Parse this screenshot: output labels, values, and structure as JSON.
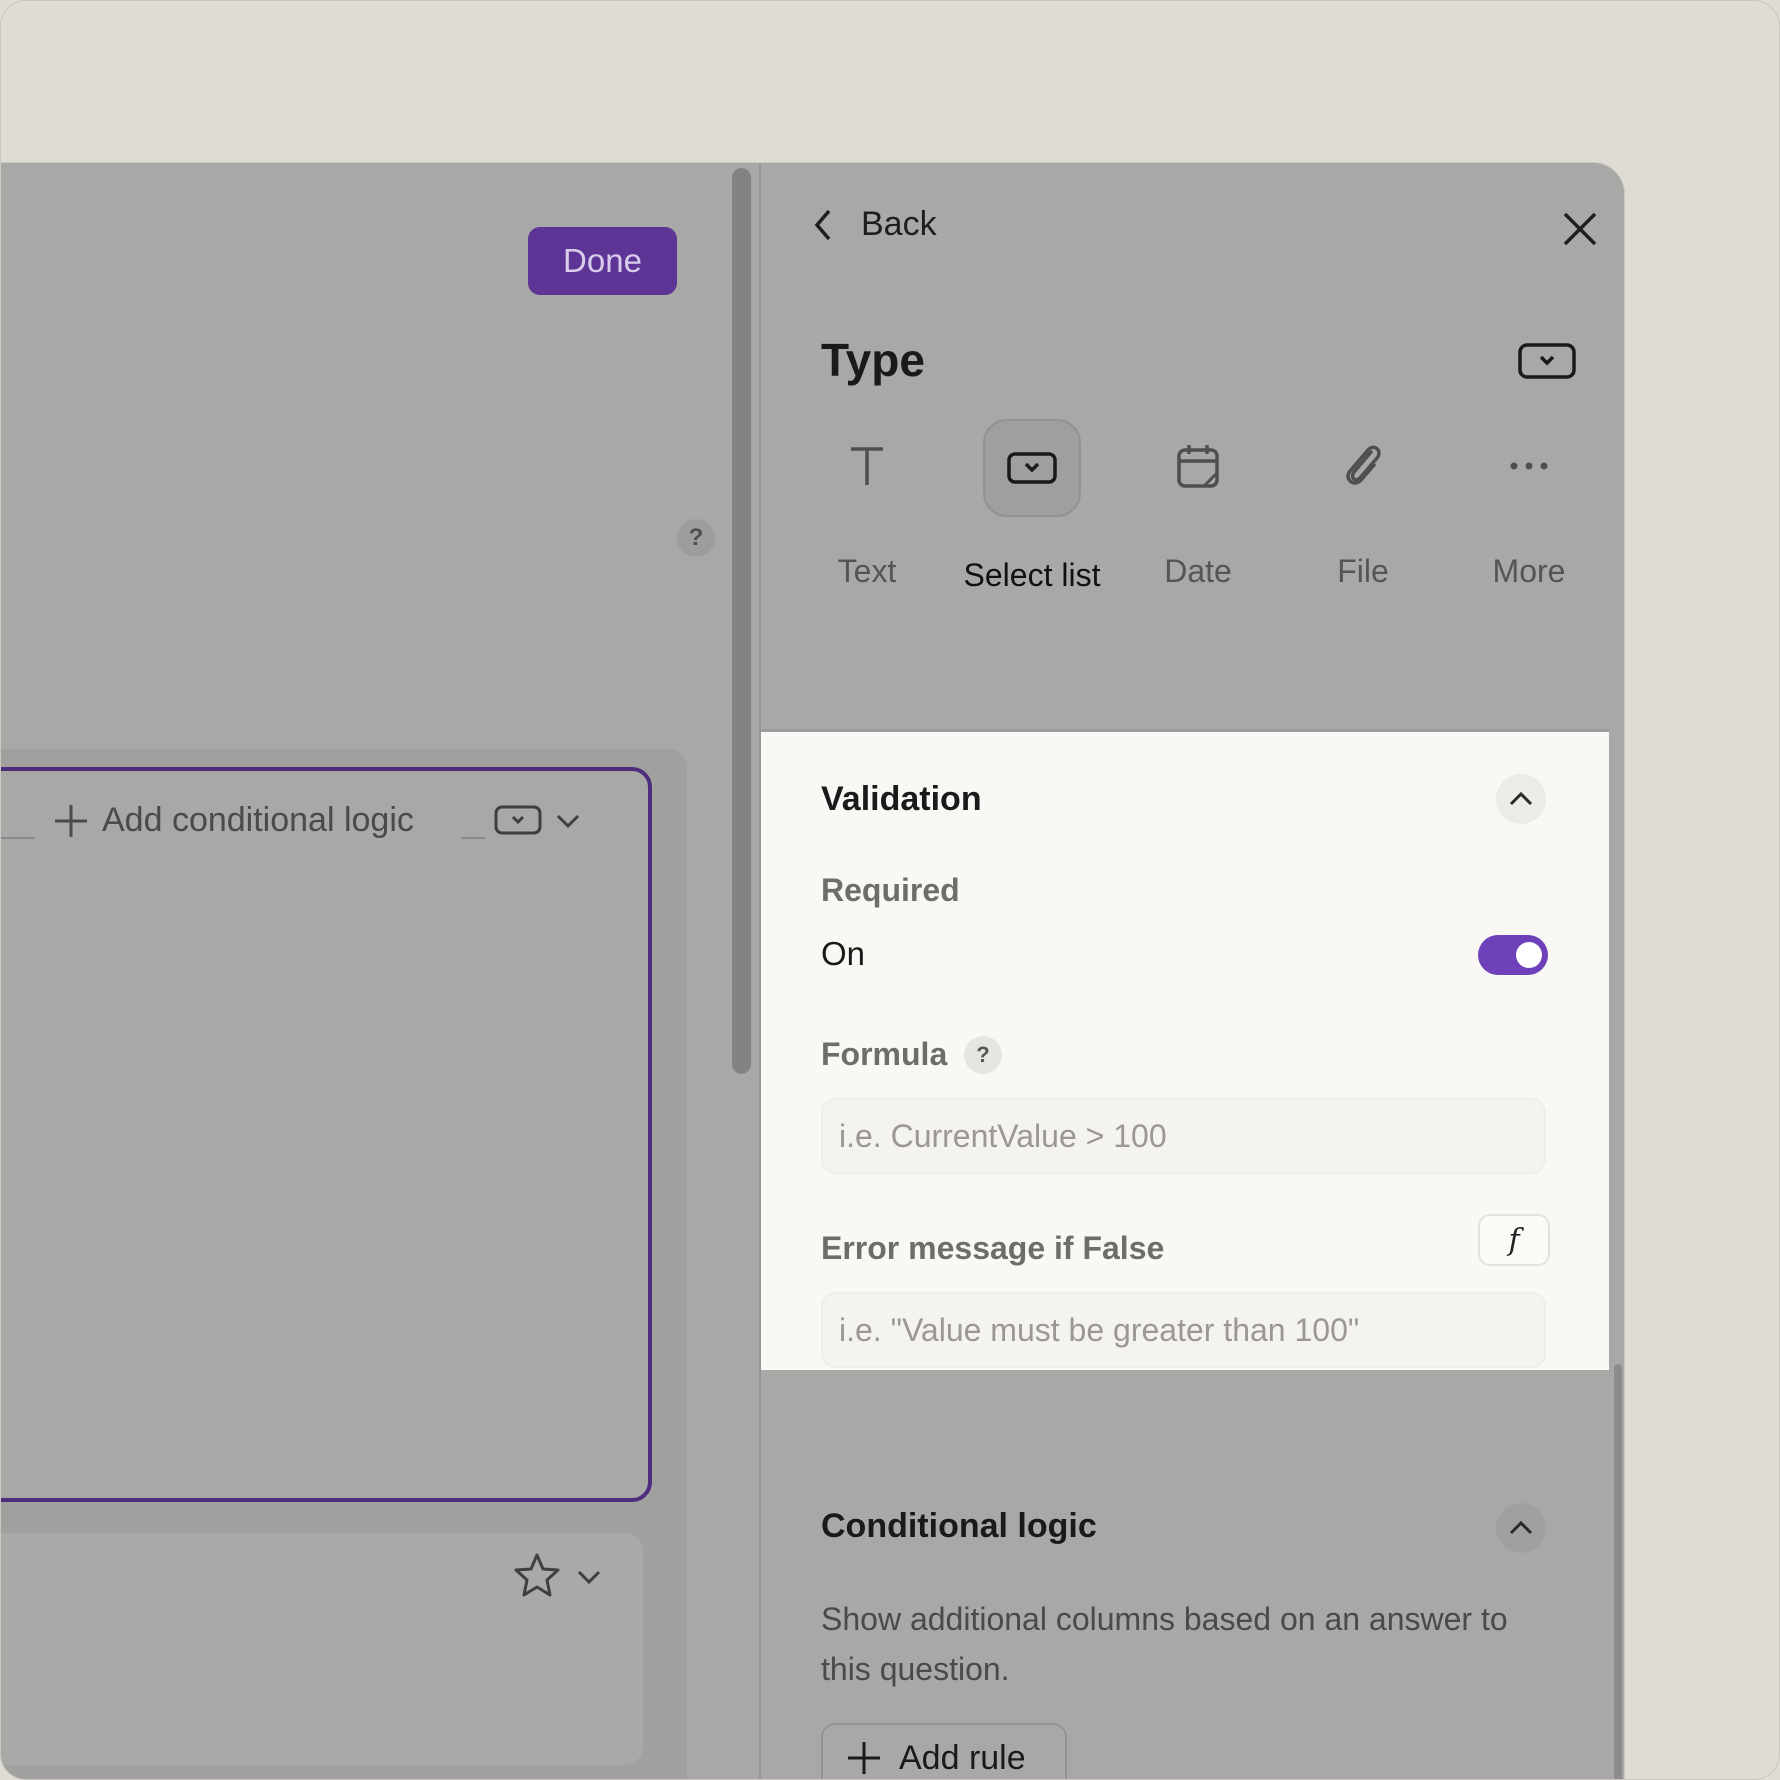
{
  "left": {
    "done_label": "Done",
    "help_label": "?",
    "add_conditional_logic_label": "Add conditional logic"
  },
  "panel": {
    "back_label": "Back",
    "type_title": "Type",
    "type_options": [
      {
        "label": "Text",
        "icon": "text-icon"
      },
      {
        "label": "Select list",
        "icon": "select-list-icon"
      },
      {
        "label": "Date",
        "icon": "calendar-icon"
      },
      {
        "label": "File",
        "icon": "paperclip-icon"
      },
      {
        "label": "More",
        "icon": "more-icon"
      }
    ],
    "selected_type": "Select list",
    "validation": {
      "title": "Validation",
      "required_label": "Required",
      "required_value": "On",
      "formula_label": "Formula",
      "formula_help": "?",
      "formula_placeholder": "i.e. CurrentValue > 100",
      "error_label": "Error message if False",
      "fx_label": "f",
      "error_placeholder": "i.e. \"Value must be greater than 100\""
    },
    "conditional": {
      "title": "Conditional logic",
      "description": "Show additional columns based on an answer to this question.",
      "add_rule_label": "Add rule"
    }
  },
  "colors": {
    "accent": "#5e3596",
    "toggle_on": "#6e40ba",
    "overlay": "#a8a8a7",
    "panel_surface": "#f9f8f5"
  }
}
